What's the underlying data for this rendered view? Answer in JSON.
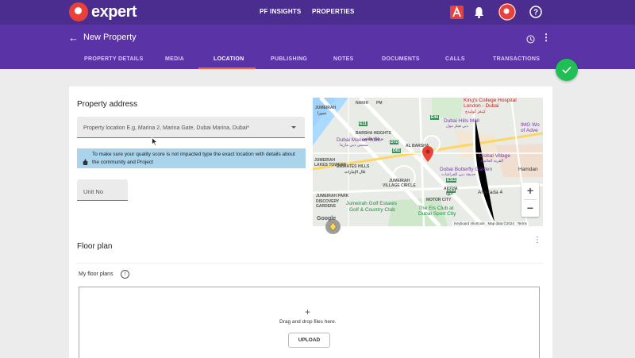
{
  "app": {
    "brand": "expert"
  },
  "topnav": {
    "insights": "PF INSIGHTS",
    "properties": "PROPERTIES"
  },
  "header": {
    "title": "New Property"
  },
  "tabs": [
    "PROPERTY DETAILS",
    "MEDIA",
    "LOCATION",
    "PUBLISHING",
    "NOTES",
    "DOCUMENTS",
    "CALLS",
    "TRANSACTIONS"
  ],
  "active_tab": "LOCATION",
  "address": {
    "heading": "Property address",
    "location_placeholder": "Property location E.g, Marina 2, Marina Gate, Dubai Marina, Dubai*",
    "info_text": "To make sure your quality score is not impacted type the exact location with details about the community and Project",
    "unit_placeholder": "Unit No"
  },
  "map": {
    "labels": {
      "jumeirah": "JUMEIRAH",
      "jumeirah_ar": "جميرا",
      "barsha_heights": "BARSHA HEIGHTS",
      "barsha_heights_ar": "برشاء هايتس",
      "al_barsha": "AL BARSHA",
      "emirates_hills": "EMIRATES HILLS",
      "emirates_hills_ar": "تلال الإمارات",
      "jlt": "JUMEIRAH",
      "jlt2": "LAKES TOWERS",
      "jumeirah_park": "JUMEIRAH PARK",
      "discovery": "DISCOVERY",
      "gardens": "GARDENS",
      "jvc": "JUMEIRAH",
      "jvc2": "VILLAGE CIRCLE",
      "motor_city": "MOTOR CITY",
      "akoya": "AKOYA",
      "akoya_ar": "أكويا",
      "nakhi": "NAKHI",
      "pm": "PM"
    },
    "pois": {
      "kings_college": "King's College Hospital",
      "kings_college2": "London - Dubai",
      "kings_college_ar": "كينغز كوليدج",
      "dubai_hills_mall": "Dubai Hills Mall",
      "dubai_hills_mall_ar": "دبي هيلز مول",
      "dubai_marina_walk": "Dubai Marina Walk",
      "dubai_marina_walk_ar": "ممشى دبي مارينا",
      "img": "IMG Wo",
      "img2": "of Adve",
      "global_village": "Global Village",
      "global_village_ar": "القرية العالمية",
      "butterfly": "Dubai Butterfly Garden",
      "butterfly_ar": "حديقة دبي للفراشات",
      "hamdan": "Hamdan",
      "alvorada": "Alvorada 4",
      "golf": "Jumeirah Golf Estates",
      "golf2": "Golf & Country Club",
      "els": "The Els Club at",
      "els2": "Dubai Sport City"
    },
    "roads": [
      "E11",
      "E44",
      "D61",
      "D72",
      "D63",
      "E311"
    ],
    "google": "Google",
    "footer": [
      "Keyboard shortcuts",
      "Map data ©2024",
      "Terms"
    ]
  },
  "floor_plan": {
    "heading": "Floor plan",
    "label": "My floor plans",
    "drop_text": "Drag and drop files here.",
    "upload_label": "UPLOAD"
  },
  "colors": {
    "topbar": "#4a2d8f",
    "subbar": "#5a33a6",
    "accent": "#ff5a36",
    "fab": "#1fbf55",
    "info_bg": "#a9d4ec"
  }
}
